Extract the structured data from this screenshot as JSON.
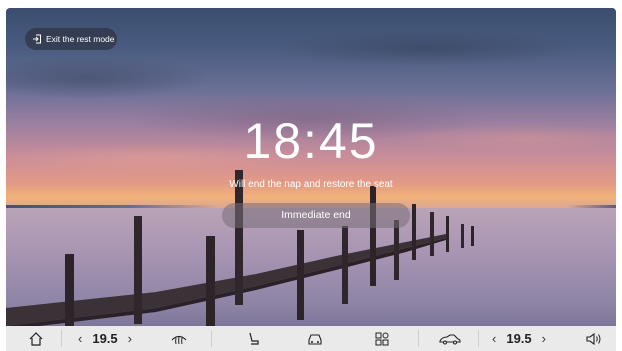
{
  "rest_mode": {
    "exit_label": "Exit the rest mode",
    "time": "18:45",
    "message": "Will end the nap and restore the seat",
    "end_button_label": "Immediate end"
  },
  "bottom_bar": {
    "left_temperature": "19.5",
    "right_temperature": "19.5",
    "icons": [
      "home-icon",
      "chevron-left-icon",
      "chevron-right-icon",
      "rear-defrost-icon",
      "seat-icon",
      "car-icon",
      "apps-icon",
      "car-side-icon",
      "volume-icon"
    ]
  }
}
